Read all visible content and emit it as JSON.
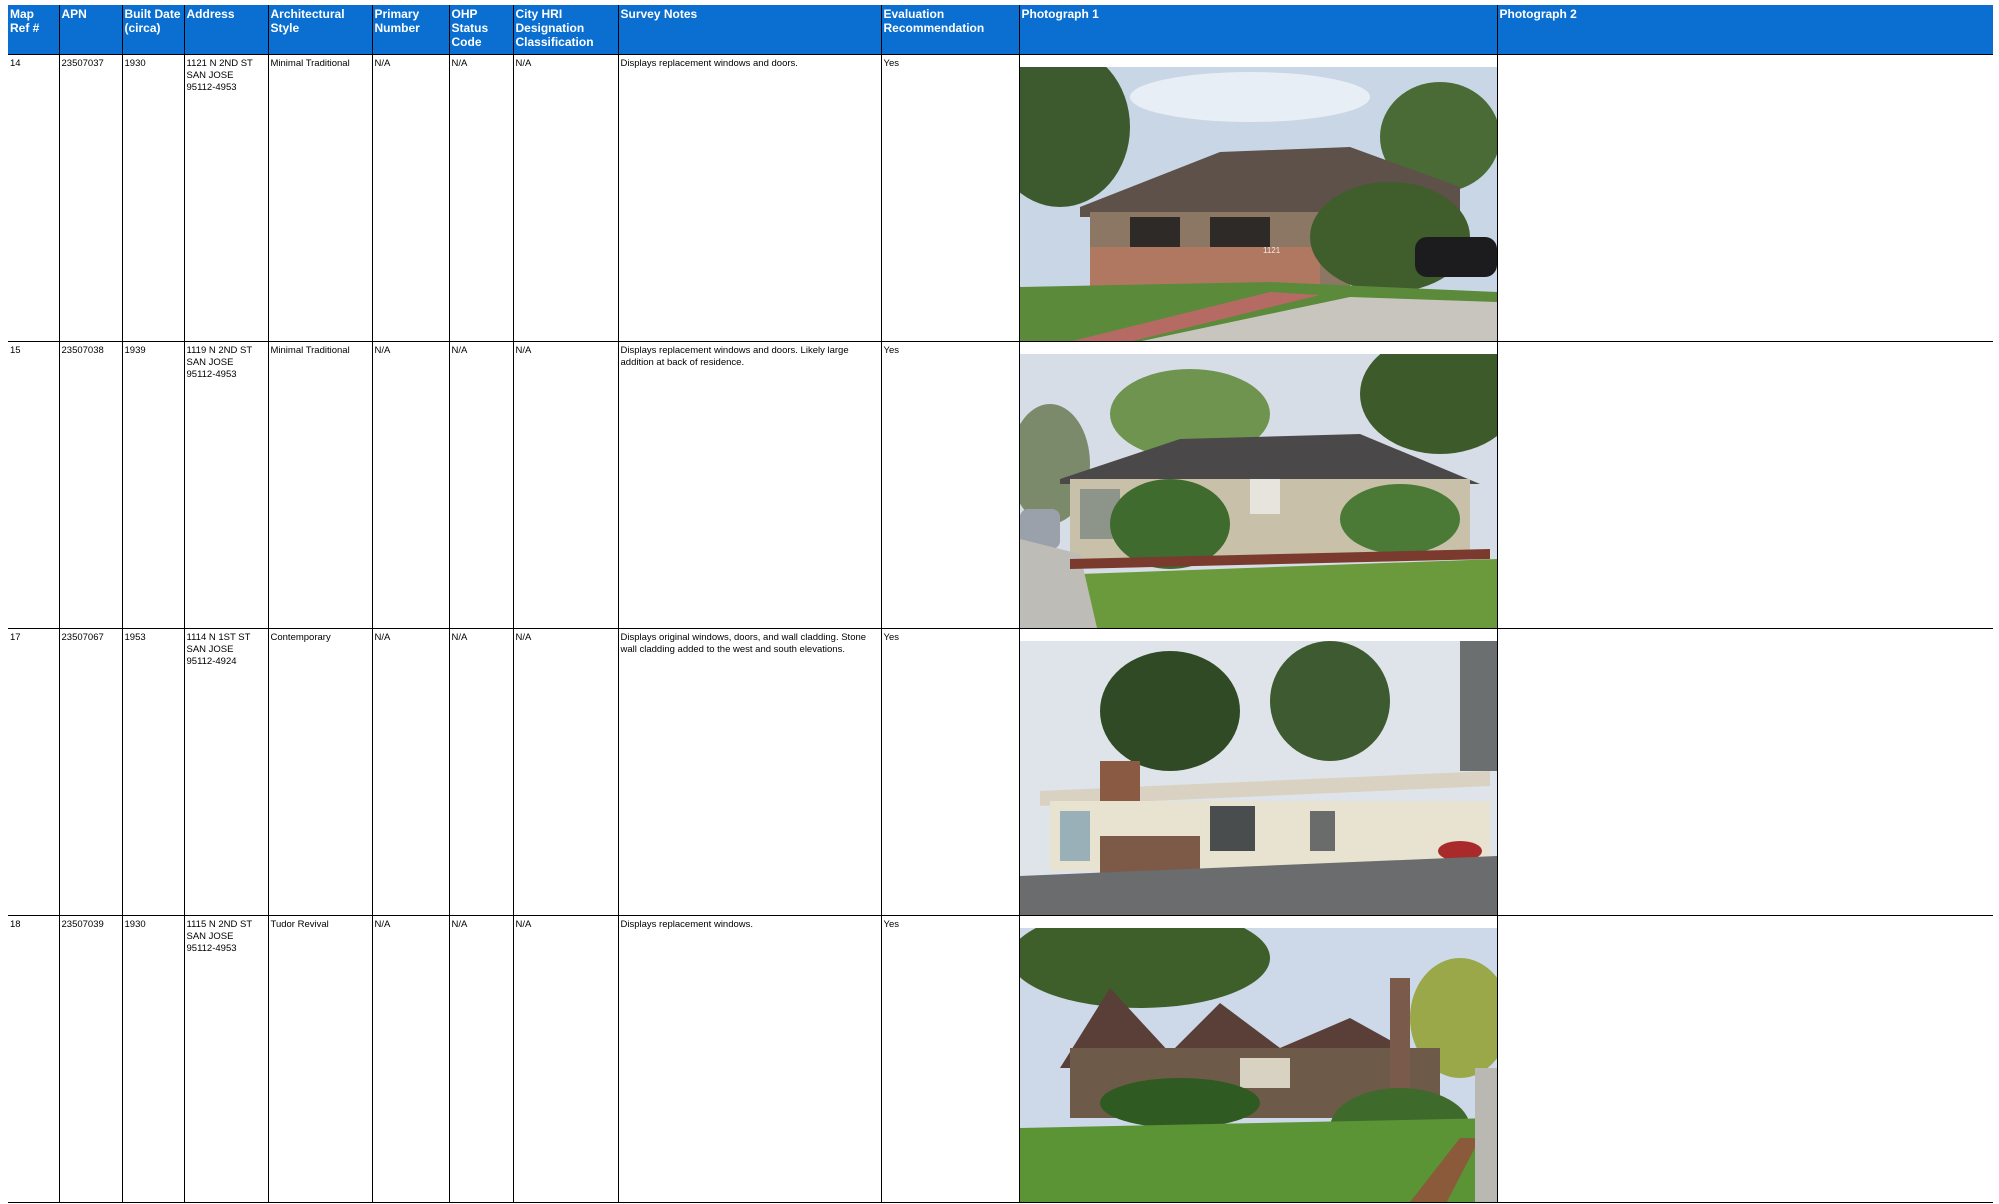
{
  "headers": {
    "map_ref": "Map Ref #",
    "apn": "APN",
    "built": "Built Date (circa)",
    "address": "Address",
    "style": "Architectural Style",
    "primary": "Primary Number",
    "ohp": "OHP Status Code",
    "hri": "City HRI Designation Classification",
    "notes": "Survey Notes",
    "eval": "Evaluation Recommendation",
    "photo1": "Photograph 1",
    "photo2": "Photograph 2"
  },
  "rows": [
    {
      "map_ref": "14",
      "apn": "23507037",
      "built": "1930",
      "address": "1121 N 2ND ST\nSAN JOSE\n95112-4953",
      "style": "Minimal Traditional",
      "primary": "N/A",
      "ohp": "N/A",
      "hri": "N/A",
      "notes": "Displays replacement windows and doors.",
      "eval": "Yes",
      "photo_number": "1121"
    },
    {
      "map_ref": "15",
      "apn": "23507038",
      "built": "1939",
      "address": "1119 N 2ND ST\nSAN JOSE\n95112-4953",
      "style": "Minimal Traditional",
      "primary": "N/A",
      "ohp": "N/A",
      "hri": "N/A",
      "notes": "Displays replacement windows and doors. Likely large addition at back of residence.",
      "eval": "Yes",
      "photo_number": ""
    },
    {
      "map_ref": "17",
      "apn": "23507067",
      "built": "1953",
      "address": "1114 N 1ST ST\nSAN JOSE\n95112-4924",
      "style": "Contemporary",
      "primary": "N/A",
      "ohp": "N/A",
      "hri": "N/A",
      "notes": "Displays original windows, doors, and wall cladding. Stone wall cladding added to the west and south elevations.",
      "eval": "Yes",
      "photo_number": ""
    },
    {
      "map_ref": "18",
      "apn": "23507039",
      "built": "1930",
      "address": "1115 N 2ND ST\nSAN JOSE\n95112-4953",
      "style": "Tudor Revival",
      "primary": "N/A",
      "ohp": "N/A",
      "hri": "N/A",
      "notes": "Displays replacement windows.",
      "eval": "Yes",
      "photo_number": ""
    }
  ],
  "colors": {
    "header_bg": "#0a6fd0",
    "header_text": "#ffffff",
    "grid": "#000000"
  }
}
